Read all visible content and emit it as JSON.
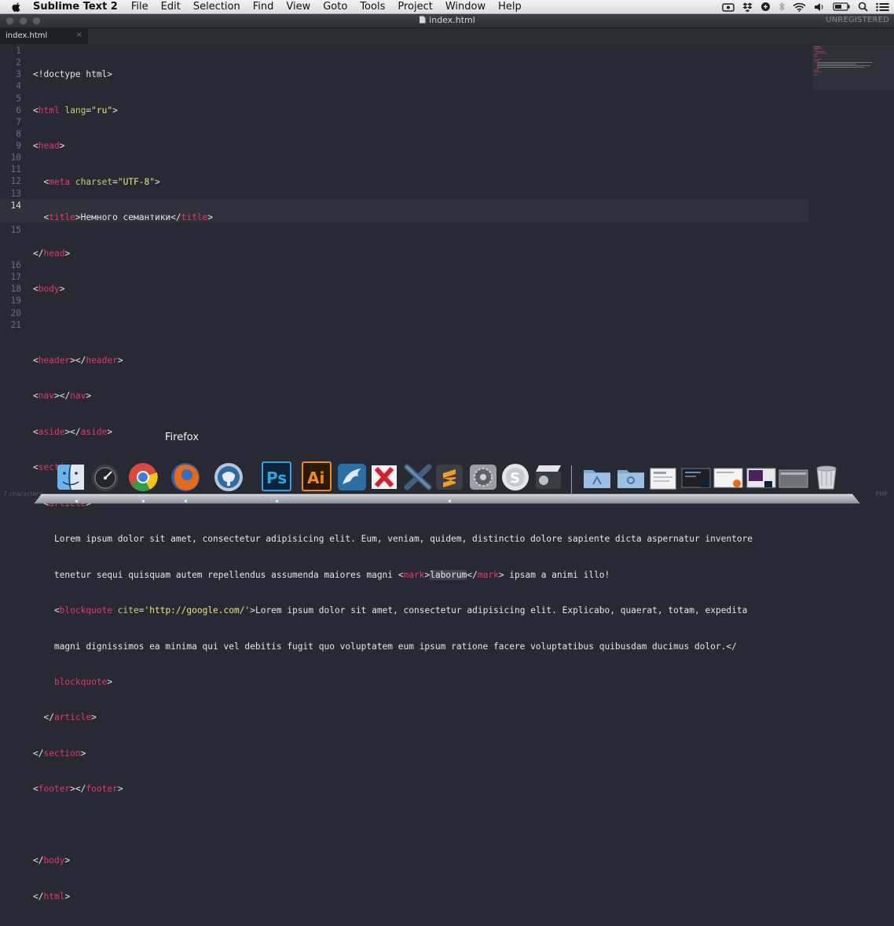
{
  "menubar": {
    "app_name": "Sublime Text 2",
    "items": [
      "File",
      "Edit",
      "Selection",
      "Find",
      "View",
      "Goto",
      "Tools",
      "Project",
      "Window",
      "Help"
    ],
    "status_icons": [
      "video-icon",
      "dropbox-icon",
      "sync-icon",
      "bluetooth-icon",
      "wifi-icon",
      "volume-icon",
      "battery-icon",
      "spotlight-icon",
      "notification-list-icon"
    ]
  },
  "window": {
    "title": "index.html",
    "registration": "UNREGISTERED"
  },
  "tabs": [
    {
      "label": "index.html",
      "close": "×"
    }
  ],
  "editor": {
    "current_line": 14,
    "line_numbers": [
      "1",
      "2",
      "3",
      "4",
      "5",
      "6",
      "7",
      "8",
      "9",
      "10",
      "11",
      "12",
      "13",
      "14",
      "15",
      "16",
      "17",
      "18",
      "19",
      "20",
      "21"
    ],
    "code": {
      "l1": "<!doctype html>",
      "l2_tag": "html",
      "l2_attr": "lang",
      "l2_val": "\"ru\"",
      "l3_tag": "head",
      "l4_tag": "meta",
      "l4_attr": "charset",
      "l4_val": "\"UTF-8\"",
      "l5_tag": "title",
      "l5_text": "Немного семантики",
      "l6_tag": "head",
      "l7_tag": "body",
      "l9_tag": "header",
      "l10_tag": "nav",
      "l11_tag": "aside",
      "l12_tag": "section",
      "l13_tag": "article",
      "l14a": "Lorem ipsum dolor sit amet, consectetur adipisicing elit. Eum, veniam, quidem, distinctio dolore sapiente dicta aspernatur inventore",
      "l14b_pre": "tenetur sequi quisquam autem repellendus assumenda maiores magni ",
      "l14b_tag": "mark",
      "l14b_word": "laborum",
      "l14b_post": " ipsam a animi illo!",
      "l15_tag": "blockquote",
      "l15_attr": "cite",
      "l15_val": "'http://google.com/'",
      "l15_text": "Lorem ipsum dolor sit amet, consectetur adipisicing elit. Explicabo, quaerat, totam, expedita",
      "l15b": "magni dignissimos ea minima qui vel debitis fugit quo voluptatem eum ipsum ratione facere voluptatibus quibusdam ducimus dolor.</",
      "l15c_tag": "blockquote",
      "l16_tag": "article",
      "l17_tag": "section",
      "l18_tag": "footer",
      "l20_tag": "body",
      "l21_tag": "html"
    }
  },
  "dock": {
    "tooltip": "Firefox",
    "items": [
      {
        "name": "finder",
        "label": "Finder"
      },
      {
        "name": "dashboard",
        "label": "Dashboard"
      },
      {
        "name": "chrome",
        "label": "Google Chrome"
      },
      {
        "name": "firefox",
        "label": "Firefox"
      },
      {
        "name": "sequel",
        "label": "Sequel"
      },
      {
        "name": "photoshop",
        "label": "Ps"
      },
      {
        "name": "illustrator",
        "label": "Ai"
      },
      {
        "name": "mysql-workbench",
        "label": "MySQL"
      },
      {
        "name": "xmind",
        "label": "XMind"
      },
      {
        "name": "xcode",
        "label": "Xcode"
      },
      {
        "name": "sublime",
        "label": "S"
      },
      {
        "name": "system-preferences",
        "label": "System Preferences"
      },
      {
        "name": "skype",
        "label": "Skype"
      },
      {
        "name": "imovie",
        "label": "iMovie"
      }
    ],
    "colors": {
      "chrome_red": "#d84a3d",
      "chrome_green": "#2f9e45",
      "chrome_yellow": "#f5c518",
      "firefox_orange": "#e66a18",
      "photoshop_blue": "#2fa5e2",
      "illustrator_orange": "#f08c1a"
    }
  },
  "status": {
    "left": "7 characters",
    "right": "PHP"
  }
}
